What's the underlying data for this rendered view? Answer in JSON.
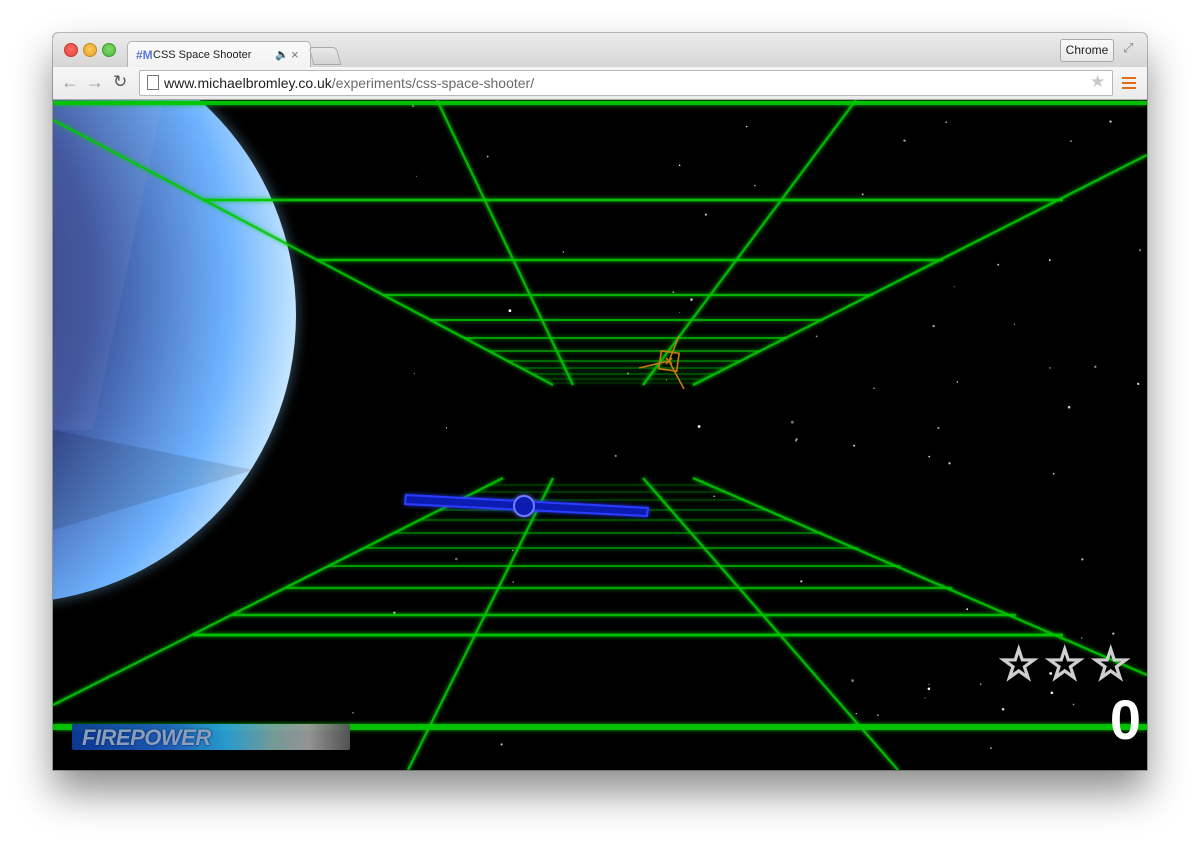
{
  "browser": {
    "tab": {
      "favicon": "#M",
      "title": "CSS Space Shooter",
      "audio_icon": "speaker-icon",
      "close_glyph": "×"
    },
    "profile_button": "Chrome",
    "url_host": "www.michaelbromley.co.uk",
    "url_path": "/experiments/css-space-shooter/",
    "icons": [
      "back-arrow-icon",
      "forward-arrow-icon",
      "reload-icon",
      "page-icon",
      "bookmark-star-icon",
      "menu-icon",
      "fullscreen-icon"
    ]
  },
  "game": {
    "firepower_label": "FIREPOWER",
    "firepower_level": 0.85,
    "lives": 3,
    "score": "0",
    "colors": {
      "grid": "#00c800",
      "ship": "#1a2cff",
      "enemy": "#c87a10",
      "planet": "#6fb4ff"
    }
  }
}
